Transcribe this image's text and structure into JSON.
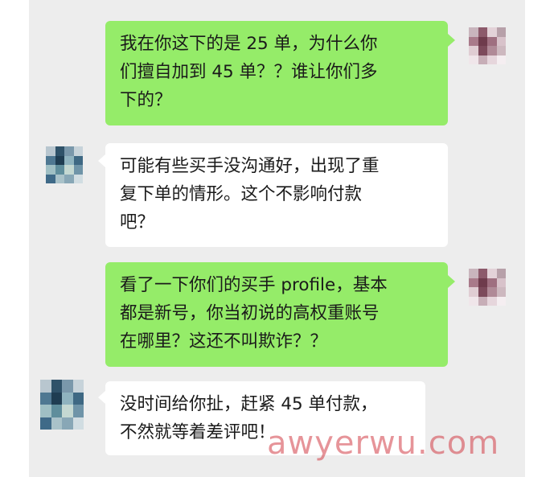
{
  "chat": {
    "messages": [
      {
        "side": "sent",
        "text": "我在你这下的是 25 单，为什么你\n们擅自加到 45 单？？谁让你们多\n下的？"
      },
      {
        "side": "recv",
        "text": "可能有些买手没沟通好，出现了重\n复下单的情形。这个不影响付款\n吧？"
      },
      {
        "side": "sent",
        "text": "看了一下你们的买手 profile，基本\n都是新号，你当初说的高权重账号\n在哪里？这还不叫欺诈？？"
      },
      {
        "side": "recv",
        "text": "没时间给你扯，赶紧 45 单付款，\n不然就等着差评吧！"
      }
    ]
  },
  "watermark": {
    "text": "awyerwu.com"
  },
  "colors": {
    "background": "#ededed",
    "sent_bubble": "#95ec69",
    "received_bubble": "#ffffff",
    "text": "#1a1a1a"
  },
  "avatars": {
    "self": [
      "#c9b5bd",
      "#8c5a6b",
      "#e3d2d8",
      "#b7a0a9",
      "#a97a8a",
      "#6e3b4c",
      "#9f6f80",
      "#d8c2ca",
      "#e0cdd3",
      "#7c4a5b",
      "#b08a97",
      "#cdb8bf",
      "#f0e6ea",
      "#c7aeb7",
      "#e6d6dc",
      "#f5eef1"
    ],
    "other": [
      "#b8c6cf",
      "#2f5269",
      "#7a98ab",
      "#c7d3da",
      "#4f7892",
      "#1f3d52",
      "#8fb3bf",
      "#3e6883",
      "#9fbfc4",
      "#5f8e9c",
      "#c4d8d2",
      "#6f94a8",
      "#3f6a88",
      "#a9c2c9",
      "#88a7b6",
      "#d1dde2"
    ]
  }
}
